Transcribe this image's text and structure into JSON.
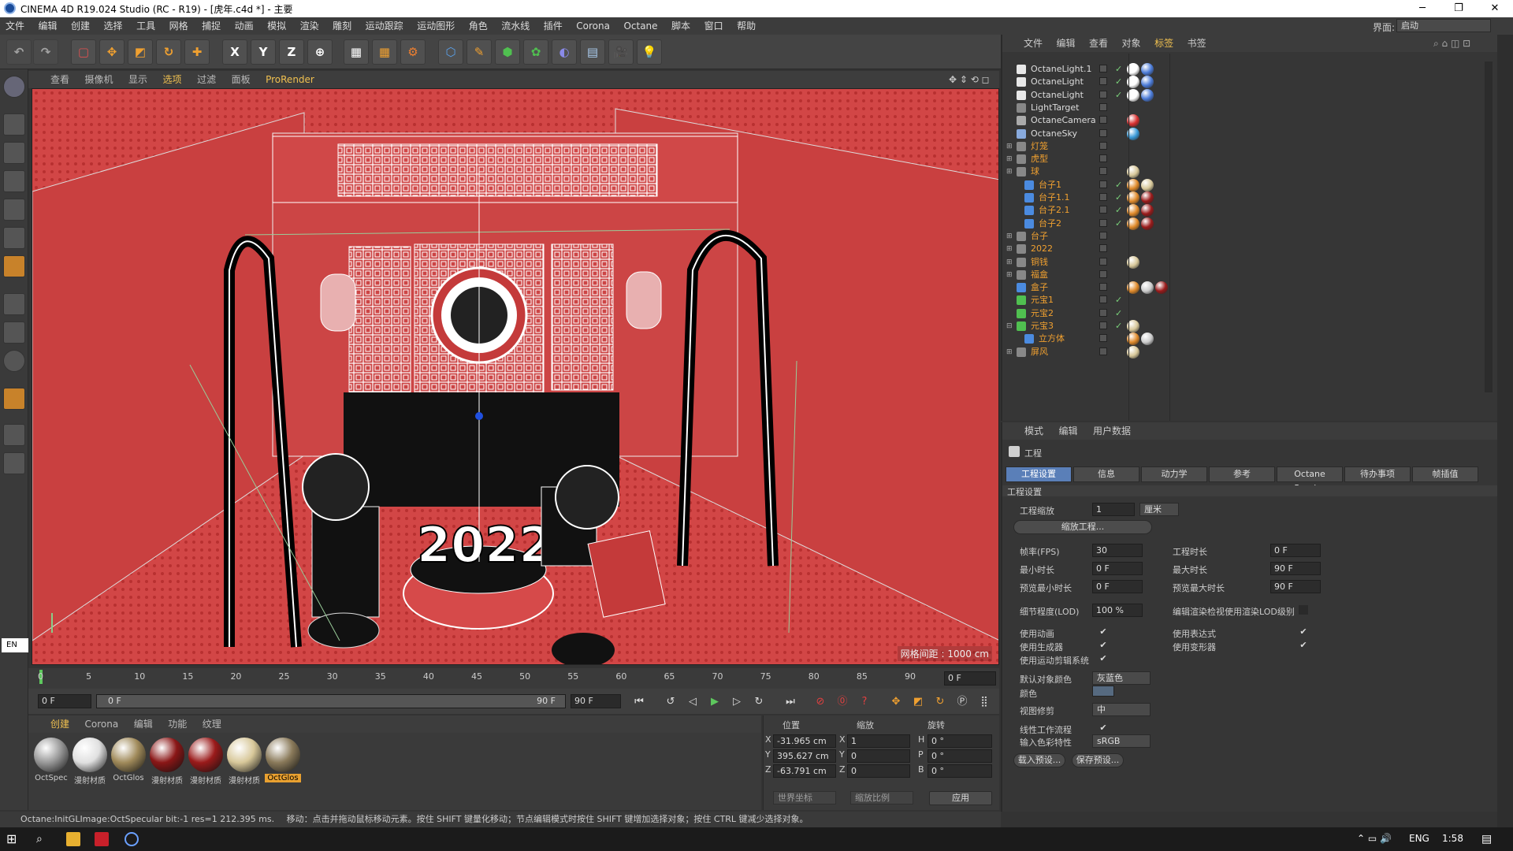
{
  "window": {
    "title": "CINEMA 4D R19.024 Studio (RC - R19) - [虎年.c4d *] - 主要"
  },
  "menubar": {
    "items": [
      "文件",
      "编辑",
      "创建",
      "选择",
      "工具",
      "网格",
      "捕捉",
      "动画",
      "模拟",
      "渲染",
      "雕刻",
      "运动跟踪",
      "运动图形",
      "角色",
      "流水线",
      "插件",
      "Corona",
      "Octane",
      "脚本",
      "窗口",
      "帮助"
    ],
    "layout_label": "界面:",
    "layout_value": "启动"
  },
  "toolbar": {
    "axis_x": "X",
    "axis_y": "Y",
    "axis_z": "Z"
  },
  "viewport": {
    "menu": [
      "查看",
      "摄像机",
      "显示",
      "选项",
      "过滤",
      "面板",
      "ProRender"
    ],
    "grid_info": "网格间距 : 1000 cm",
    "scene_text": "2022",
    "colors": {
      "background": "#d44848",
      "wall": "#c83c3c"
    }
  },
  "timeline": {
    "ticks": [
      "0",
      "5",
      "10",
      "15",
      "20",
      "25",
      "30",
      "35",
      "40",
      "45",
      "50",
      "55",
      "60",
      "65",
      "70",
      "75",
      "80",
      "85",
      "90"
    ],
    "current_frame": "0 F",
    "start": "0 F",
    "range_start": "0 F",
    "range_end": "90 F",
    "end": "90 F"
  },
  "materials": {
    "menu": [
      "创建",
      "Corona",
      "编辑",
      "功能",
      "纹理"
    ],
    "items": [
      {
        "name": "OctSpec",
        "color": "#999999"
      },
      {
        "name": "漫射材质",
        "color": "#e0e0e0"
      },
      {
        "name": "OctGlos",
        "color": "#a08a5a"
      },
      {
        "name": "漫射材质",
        "color": "#8a1616"
      },
      {
        "name": "漫射材质",
        "color": "#9a1a1a"
      },
      {
        "name": "漫射材质",
        "color": "#d8c89a"
      },
      {
        "name": "OctGlos",
        "color": "#8a7a5a",
        "selected": true
      }
    ]
  },
  "coordinates": {
    "headers": [
      "位置",
      "缩放",
      "旋转"
    ],
    "rows": [
      {
        "axis": "X",
        "pos": "-31.965 cm",
        "saxis": "X",
        "scale": "1",
        "raxis": "H",
        "rot": "0 °"
      },
      {
        "axis": "Y",
        "pos": "395.627 cm",
        "saxis": "Y",
        "scale": "0",
        "raxis": "P",
        "rot": "0 °"
      },
      {
        "axis": "Z",
        "pos": "-63.791 cm",
        "saxis": "Z",
        "scale": "0",
        "raxis": "B",
        "rot": "0 °"
      }
    ],
    "world_coord": "世界坐标",
    "scale_ratio": "缩放比例",
    "apply": "应用"
  },
  "statusbar": {
    "left": "Octane:InitGLImage:OctSpecular  bit:-1 res=1  212.395 ms.",
    "right": "移动：点击并拖动鼠标移动元素。按住 SHIFT 键量化移动；节点编辑模式时按住 SHIFT 键增加选择对象；按住 CTRL 键减少选择对象。"
  },
  "lang_indicator": "EN",
  "object_manager": {
    "menu": [
      "文件",
      "编辑",
      "查看",
      "对象",
      "标签",
      "书签"
    ],
    "rows": [
      {
        "name": "OctaneLight.1",
        "indent": 0,
        "icon": "#e8e8e8",
        "expand": "",
        "check": true,
        "tags": [
          "#ffffff",
          "#4b7bd8"
        ],
        "orange": false
      },
      {
        "name": "OctaneLight",
        "indent": 0,
        "icon": "#e8e8e8",
        "expand": "",
        "check": true,
        "tags": [
          "#ffffff",
          "#4b7bd8"
        ],
        "orange": false
      },
      {
        "name": "OctaneLight",
        "indent": 0,
        "icon": "#e8e8e8",
        "expand": "",
        "check": true,
        "tags": [
          "#ffffff",
          "#4b7bd8"
        ],
        "orange": false
      },
      {
        "name": "LightTarget",
        "indent": 0,
        "icon": "#888888",
        "expand": "",
        "check": false,
        "tags": [],
        "orange": false
      },
      {
        "name": "OctaneCamera",
        "indent": 0,
        "icon": "#aaaaaa",
        "expand": "",
        "check": false,
        "tags": [
          "#d83030"
        ],
        "orange": false
      },
      {
        "name": "OctaneSky",
        "indent": 0,
        "icon": "#88aadd",
        "expand": "",
        "check": false,
        "tags": [
          "#3a9ad8"
        ],
        "orange": false
      },
      {
        "name": "灯笼",
        "indent": 0,
        "icon": "#888888",
        "expand": "+",
        "check": false,
        "tags": [],
        "orange": true
      },
      {
        "name": "虎型",
        "indent": 0,
        "icon": "#888888",
        "expand": "+",
        "check": false,
        "tags": [],
        "orange": true
      },
      {
        "name": "球",
        "indent": 0,
        "icon": "#888888",
        "expand": "+",
        "check": false,
        "tags": [
          "#d8c89a"
        ],
        "orange": true
      },
      {
        "name": "台子1",
        "indent": 1,
        "icon": "#4b8be0",
        "expand": "",
        "check": true,
        "tags": [
          "#e08a2a",
          "#d8c89a"
        ],
        "orange": true
      },
      {
        "name": "台子1.1",
        "indent": 1,
        "icon": "#4b8be0",
        "expand": "",
        "check": true,
        "tags": [
          "#e08a2a",
          "#9a1a1a"
        ],
        "orange": true
      },
      {
        "name": "台子2.1",
        "indent": 1,
        "icon": "#4b8be0",
        "expand": "",
        "check": true,
        "tags": [
          "#e08a2a",
          "#9a1a1a"
        ],
        "orange": true
      },
      {
        "name": "台子2",
        "indent": 1,
        "icon": "#4b8be0",
        "expand": "",
        "check": true,
        "tags": [
          "#e08a2a",
          "#9a1a1a"
        ],
        "orange": true
      },
      {
        "name": "台子",
        "indent": 0,
        "icon": "#888888",
        "expand": "+",
        "check": false,
        "tags": [],
        "orange": true
      },
      {
        "name": "2022",
        "indent": 0,
        "icon": "#888888",
        "expand": "+",
        "check": false,
        "tags": [],
        "orange": true
      },
      {
        "name": "铜钱",
        "indent": 0,
        "icon": "#888888",
        "expand": "+",
        "check": false,
        "tags": [
          "#d8c89a"
        ],
        "orange": true
      },
      {
        "name": "福盒",
        "indent": 0,
        "icon": "#888888",
        "expand": "+",
        "check": false,
        "tags": [],
        "orange": true
      },
      {
        "name": "盒子",
        "indent": 0,
        "icon": "#4b8be0",
        "expand": "",
        "check": false,
        "tags": [
          "#e08a2a",
          "#cccccc",
          "#9a1a1a"
        ],
        "orange": true
      },
      {
        "name": "元宝1",
        "indent": 0,
        "icon": "#50c050",
        "expand": "",
        "check": true,
        "tags": [],
        "orange": true
      },
      {
        "name": "元宝2",
        "indent": 0,
        "icon": "#50c050",
        "expand": "",
        "check": true,
        "tags": [],
        "orange": true
      },
      {
        "name": "元宝3",
        "indent": 0,
        "icon": "#50c050",
        "expand": "-",
        "check": true,
        "tags": [
          "#d8c89a"
        ],
        "orange": true
      },
      {
        "name": "立方体",
        "indent": 1,
        "icon": "#4b8be0",
        "expand": "",
        "check": false,
        "tags": [
          "#e08a2a",
          "#cccccc"
        ],
        "orange": true
      },
      {
        "name": "屏风",
        "indent": 0,
        "icon": "#888888",
        "expand": "+",
        "check": false,
        "tags": [
          "#d8c89a"
        ],
        "orange": true
      }
    ]
  },
  "attributes": {
    "menu": [
      "模式",
      "编辑",
      "用户数据"
    ],
    "title": "工程",
    "tabs": [
      "工程设置",
      "信息",
      "动力学",
      "参考",
      "Octane Render",
      "待办事项",
      "帧插值"
    ],
    "section": "工程设置",
    "project_scale_label": "工程缩放",
    "project_scale_value": "1",
    "project_scale_unit": "厘米",
    "scale_project_btn": "缩放工程...",
    "fps_label": "帧率(FPS)",
    "fps_value": "30",
    "project_time_label": "工程时长",
    "project_time_value": "0 F",
    "min_time_label": "最小时长",
    "min_time_value": "0 F",
    "max_time_label": "最大时长",
    "max_time_value": "90 F",
    "preview_min_label": "预览最小时长",
    "preview_min_value": "0 F",
    "preview_max_label": "预览最大时长",
    "preview_max_value": "90 F",
    "lod_label": "细节程度(LOD)",
    "lod_value": "100 %",
    "lod_render_label": "编辑渲染检视使用渲染LOD级别",
    "use_anim_label": "使用动画",
    "use_expr_label": "使用表达式",
    "use_gen_label": "使用生成器",
    "use_deform_label": "使用变形器",
    "use_motion_label": "使用运动剪辑系统",
    "default_color_label": "默认对象颜色",
    "default_color_value": "灰蓝色",
    "color_label": "颜色",
    "view_clip_label": "视图修剪",
    "view_clip_value": "中",
    "linear_label": "线性工作流程",
    "input_color_label": "输入色彩特性",
    "input_color_value": "sRGB",
    "load_preset": "载入预设...",
    "save_preset": "保存预设..."
  },
  "taskbar": {
    "lang": "ENG",
    "time": "1:58"
  }
}
